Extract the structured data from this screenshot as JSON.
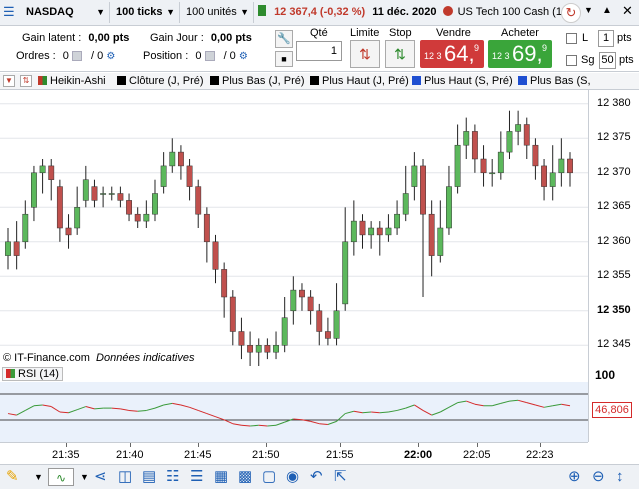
{
  "topbar": {
    "instrument": "NASDAQ",
    "ticks": "100 ticks",
    "units": "100 unités",
    "quote": "12 367,4 (-0,32 %)",
    "date": "11 déc. 2020",
    "market": "US Tech 100 Cash (1",
    "dropdown_glyph": "▼"
  },
  "header": {
    "gain_latent_label": "Gain latent :",
    "gain_latent_value": "0,00 pts",
    "gain_jour_label": "Gain Jour :",
    "gain_jour_value": "0,00 pts",
    "ordres_label": "Ordres :",
    "ordres_value": "0",
    "ordres_sep": "/ 0",
    "position_label": "Position :",
    "position_value": "0",
    "position_sep": "/ 0",
    "qte_label": "Qté",
    "qte_value": "1",
    "limite_label": "Limite",
    "stop_label": "Stop",
    "vendre_label": "Vendre",
    "acheter_label": "Acheter",
    "sell_small": "12 3",
    "sell_big": "64,",
    "sell_sup": "9",
    "buy_small": "12 3",
    "buy_big": "69,",
    "buy_sup": "9",
    "l_label": "L",
    "pts_value": "1",
    "pts_label": "pts",
    "sg_label": "Sg",
    "sg_value": "50",
    "sg_pts": "pts"
  },
  "tabs": [
    {
      "label": "Heikin-Ashi",
      "color": "#2e8b2e"
    },
    {
      "label": "Clôture (J, Pré)",
      "color": "#000000"
    },
    {
      "label": "Plus Bas (J, Pré)",
      "color": "#000000"
    },
    {
      "label": "Plus Haut (J, Pré)",
      "color": "#000000"
    },
    {
      "label": "Plus Haut (S, Pré)",
      "color": "#1f4fd1"
    },
    {
      "label": "Plus Bas (S,",
      "color": "#1f4fd1"
    }
  ],
  "chart": {
    "watermark": "© IT-Finance.com",
    "watermark_note": "Données indicatives",
    "y_ticks": [
      "12 380",
      "12 375",
      "12 370",
      "12 365",
      "12 360",
      "12 355",
      "12 350",
      "12 345"
    ],
    "x_ticks": [
      "21:35",
      "21:40",
      "21:45",
      "21:50",
      "21:55",
      "22:00",
      "22:05",
      "22:23"
    ],
    "colors": {
      "up": "#5cb85c",
      "down": "#c0504d"
    }
  },
  "rsi": {
    "label": "RSI (14)",
    "top_value": "100",
    "current_value": "46,806",
    "colors": {
      "up": "#3a9a3a",
      "down": "#d42a2a"
    }
  },
  "chart_data": {
    "type": "candlestick",
    "y_axis_ticks": [
      12380,
      12375,
      12370,
      12365,
      12360,
      12355,
      12350,
      12345
    ],
    "ylim": [
      12342,
      12382
    ],
    "candles": [
      [
        12358,
        12360,
        12356,
        12362
      ],
      [
        12360,
        12358,
        12356,
        12363
      ],
      [
        12360,
        12364,
        12359,
        12366
      ],
      [
        12365,
        12370,
        12363,
        12371
      ],
      [
        12370,
        12371,
        12367,
        12372
      ],
      [
        12371,
        12369,
        12366,
        12372
      ],
      [
        12368,
        12362,
        12360,
        12369
      ],
      [
        12362,
        12361,
        12359,
        12364
      ],
      [
        12362,
        12365,
        12361,
        12368
      ],
      [
        12366,
        12369,
        12365,
        12371
      ],
      [
        12368,
        12366,
        12365,
        12369
      ],
      [
        12367,
        12367,
        12365,
        12368
      ],
      [
        12367,
        12367,
        12366,
        12368
      ],
      [
        12367,
        12366,
        12365,
        12368
      ],
      [
        12366,
        12364,
        12363,
        12367
      ],
      [
        12364,
        12363,
        12362,
        12365
      ],
      [
        12363,
        12364,
        12362,
        12366
      ],
      [
        12364,
        12367,
        12363,
        12369
      ],
      [
        12368,
        12371,
        12367,
        12373
      ],
      [
        12371,
        12373,
        12370,
        12375
      ],
      [
        12373,
        12371,
        12369,
        12374
      ],
      [
        12371,
        12368,
        12366,
        12372
      ],
      [
        12368,
        12364,
        12362,
        12369
      ],
      [
        12364,
        12360,
        12357,
        12365
      ],
      [
        12360,
        12356,
        12354,
        12361
      ],
      [
        12356,
        12352,
        12349,
        12357
      ],
      [
        12352,
        12347,
        12345,
        12353
      ],
      [
        12347,
        12345,
        12343,
        12349
      ],
      [
        12345,
        12344,
        12342,
        12347
      ],
      [
        12344,
        12345,
        12342,
        12346
      ],
      [
        12345,
        12344,
        12343,
        12346
      ],
      [
        12344,
        12345,
        12343,
        12347
      ],
      [
        12345,
        12349,
        12344,
        12352
      ],
      [
        12350,
        12353,
        12348,
        12355
      ],
      [
        12353,
        12352,
        12350,
        12354
      ],
      [
        12352,
        12350,
        12348,
        12353
      ],
      [
        12350,
        12347,
        12345,
        12351
      ],
      [
        12347,
        12346,
        12345,
        12349
      ],
      [
        12346,
        12350,
        12345,
        12354
      ],
      [
        12351,
        12360,
        12350,
        12365
      ],
      [
        12360,
        12363,
        12358,
        12366
      ],
      [
        12363,
        12361,
        12359,
        12364
      ],
      [
        12361,
        12362,
        12359,
        12363
      ],
      [
        12362,
        12361,
        12358,
        12363
      ],
      [
        12361,
        12362,
        12360,
        12364
      ],
      [
        12362,
        12364,
        12361,
        12366
      ],
      [
        12364,
        12367,
        12363,
        12371
      ],
      [
        12368,
        12371,
        12366,
        12373
      ],
      [
        12371,
        12364,
        12352,
        12372
      ],
      [
        12364,
        12358,
        12355,
        12366
      ],
      [
        12358,
        12362,
        12357,
        12366
      ],
      [
        12362,
        12368,
        12361,
        12371
      ],
      [
        12368,
        12374,
        12367,
        12377
      ],
      [
        12374,
        12376,
        12372,
        12378
      ],
      [
        12376,
        12372,
        12370,
        12377
      ],
      [
        12372,
        12370,
        12368,
        12374
      ],
      [
        12370,
        12370,
        12368,
        12372
      ],
      [
        12370,
        12373,
        12369,
        12376
      ],
      [
        12373,
        12376,
        12372,
        12379
      ],
      [
        12376,
        12377,
        12374,
        12379
      ],
      [
        12377,
        12374,
        12372,
        12378
      ],
      [
        12374,
        12371,
        12369,
        12375
      ],
      [
        12371,
        12368,
        12366,
        12372
      ],
      [
        12368,
        12370,
        12366,
        12374
      ],
      [
        12370,
        12372,
        12368,
        12375
      ],
      [
        12372,
        12370,
        12368,
        12373
      ]
    ]
  },
  "bottombar": {
    "icons": [
      "pencil-icon",
      "indicator-icon",
      "share-icon",
      "add-chart-icon",
      "template-icon",
      "calendar-icon",
      "compare-icon",
      "tools-icon",
      "grid-icon",
      "screenshot-icon",
      "camera-icon",
      "undo-icon",
      "export-icon",
      "zoom-in-icon",
      "zoom-out-icon",
      "arrows-icon"
    ]
  }
}
